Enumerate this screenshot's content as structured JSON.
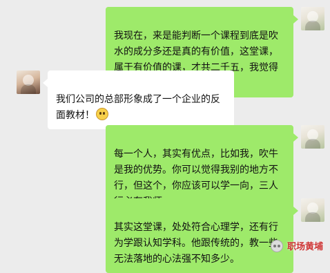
{
  "messages": [
    {
      "side": "right",
      "text": "我现在，来是能判断一个课程到底是吹水的成分多还是真的有价值，这堂课，属于有价值的课，才共二千五，我觉得超值。"
    },
    {
      "side": "left",
      "text": "我们公司的总部形象成了一个企业的反面教材！"
    },
    {
      "side": "right",
      "text": "每一个人，其实有优点，比如我，吹牛是我的优势。你可以觉得我别的地方不行，但这个，你应该可以学一向，三人行必有我师。"
    },
    {
      "side": "right",
      "text": "其实这堂课，处处符合心理学，还有行为学跟认知学科。他跟传统的，教一些无法落地的心法强不知多少。"
    }
  ],
  "watermark": {
    "text": "职场黄埔"
  },
  "colors": {
    "background": "#ececec",
    "sent_bubble": "#9eea6a",
    "received_bubble": "#ffffff",
    "watermark": "#cc3333"
  },
  "icons": {
    "emoji": "blushing-face-icon",
    "watermark": "wechat-icon"
  }
}
